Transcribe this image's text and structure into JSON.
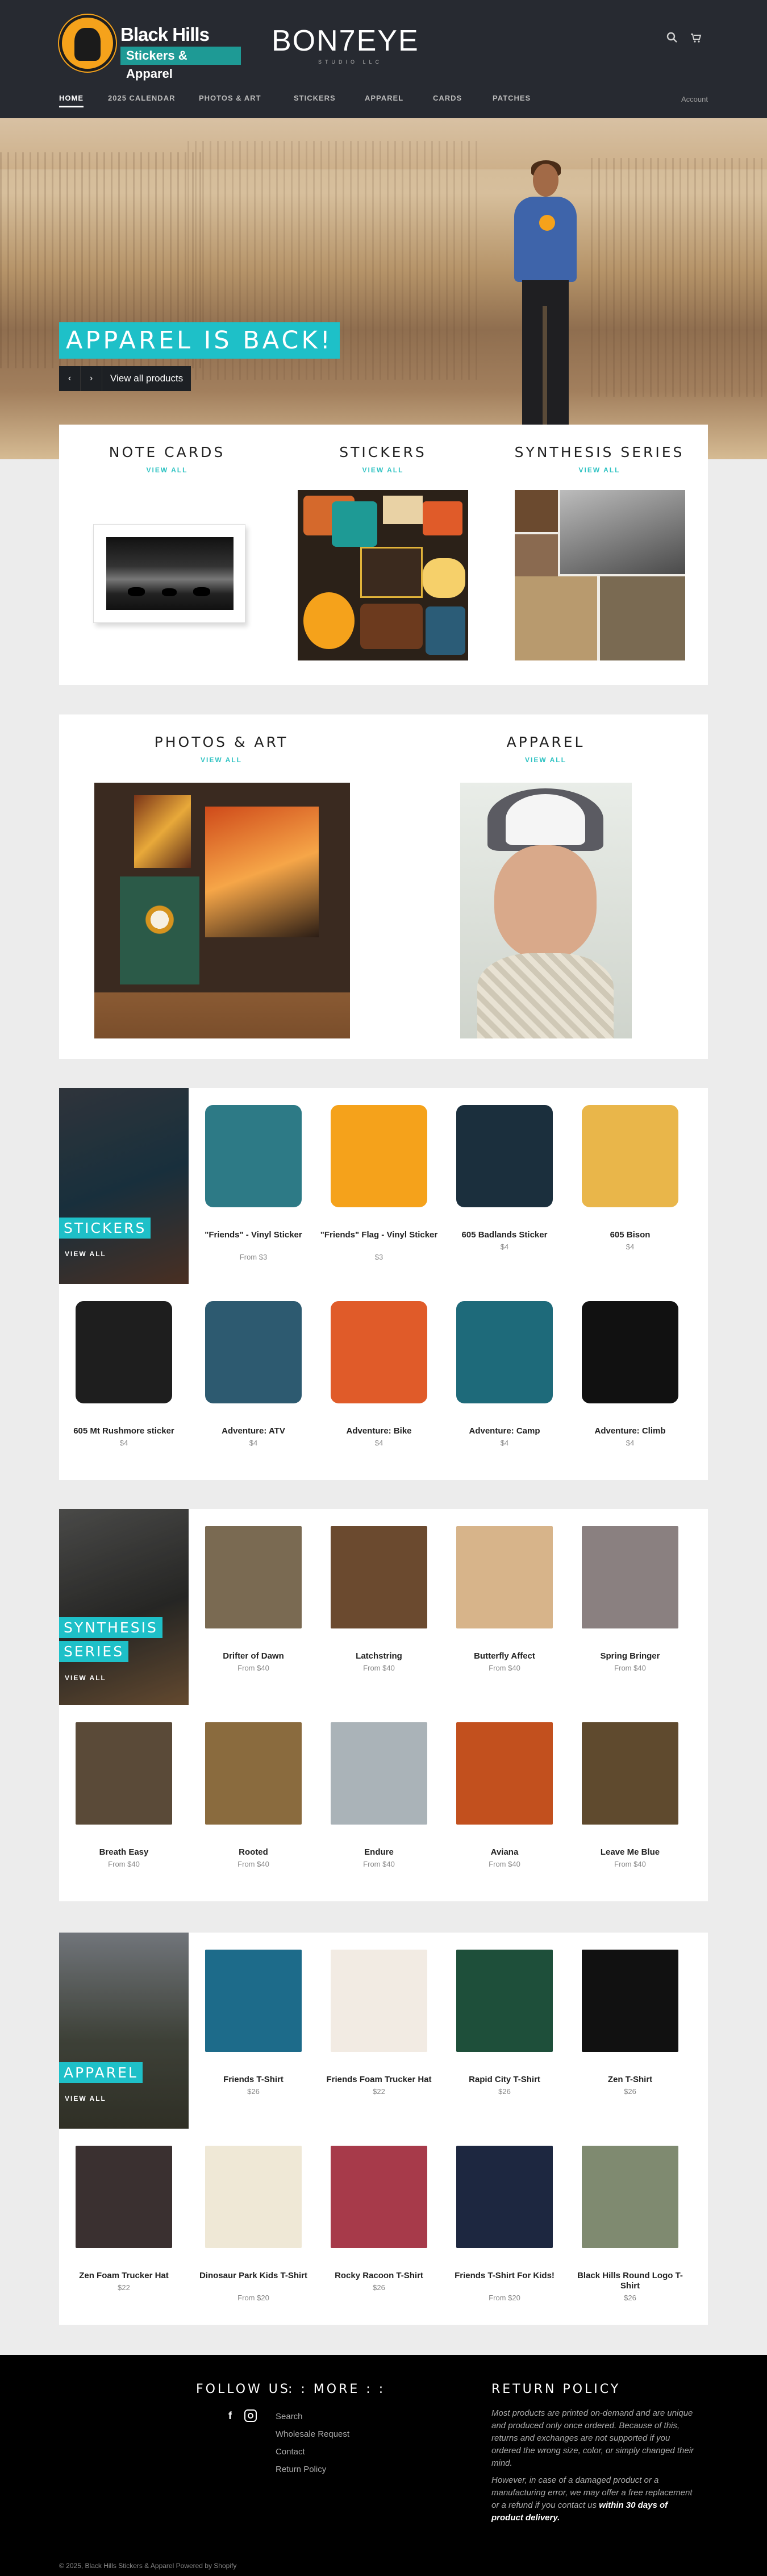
{
  "brand": {
    "name": "Black Hills",
    "subtitle": "Stickers & Apparel",
    "partner": "BON7EYE",
    "partner_sub": "STUDIO LLC"
  },
  "nav": [
    "HOME",
    "2025 CALENDAR",
    "PHOTOS & ART",
    "STICKERS",
    "APPAREL",
    "CARDS",
    "PATCHES"
  ],
  "account": "Account",
  "icons": {
    "search": "search-icon",
    "cart": "cart-icon",
    "facebook": "facebook-icon",
    "instagram": "instagram-icon"
  },
  "hero": {
    "title": "APPAREL IS BACK!",
    "prev": "‹",
    "next": "›",
    "cta": "View all products"
  },
  "view_all": "VIEW ALL",
  "collections_row1": [
    {
      "title": "NOTE CARDS"
    },
    {
      "title": "STICKERS"
    },
    {
      "title": "SYNTHESIS SERIES"
    }
  ],
  "collections_row2": [
    {
      "title": "PHOTOS & ART"
    },
    {
      "title": "APPAREL"
    }
  ],
  "sections": [
    {
      "title": "STICKERS",
      "products": [
        {
          "name": "\"Friends\" - Vinyl Sticker",
          "price": "From $3"
        },
        {
          "name": "\"Friends\" Flag - Vinyl Sticker",
          "price": "$3"
        },
        {
          "name": "605 Badlands Sticker",
          "price": "$4"
        },
        {
          "name": "605 Bison",
          "price": "$4"
        },
        {
          "name": "605 Mt Rushmore sticker",
          "price": "$4"
        },
        {
          "name": "Adventure: ATV",
          "price": "$4"
        },
        {
          "name": "Adventure: Bike",
          "price": "$4"
        },
        {
          "name": "Adventure: Camp",
          "price": "$4"
        },
        {
          "name": "Adventure: Climb",
          "price": "$4"
        }
      ]
    },
    {
      "title": "SYNTHESIS SERIES",
      "products": [
        {
          "name": "Drifter of Dawn",
          "price": "From $40"
        },
        {
          "name": "Latchstring",
          "price": "From $40"
        },
        {
          "name": "Butterfly Affect",
          "price": "From $40"
        },
        {
          "name": "Spring Bringer",
          "price": "From $40"
        },
        {
          "name": "Breath Easy",
          "price": "From $40"
        },
        {
          "name": "Rooted",
          "price": "From $40"
        },
        {
          "name": "Endure",
          "price": "From $40"
        },
        {
          "name": "Aviana",
          "price": "From $40"
        },
        {
          "name": "Leave Me Blue",
          "price": "From $40"
        }
      ]
    },
    {
      "title": "APPAREL",
      "products": [
        {
          "name": "Friends T-Shirt",
          "price": "$26"
        },
        {
          "name": "Friends Foam Trucker Hat",
          "price": "$22"
        },
        {
          "name": "Rapid City T-Shirt",
          "price": "$26"
        },
        {
          "name": "Zen T-Shirt",
          "price": "$26"
        },
        {
          "name": "Zen Foam Trucker Hat",
          "price": "$22"
        },
        {
          "name": "Dinosaur Park Kids T-Shirt",
          "price": "From $20"
        },
        {
          "name": "Rocky Racoon T-Shirt",
          "price": "$26"
        },
        {
          "name": "Friends T-Shirt For Kids!",
          "price": "From $20"
        },
        {
          "name": "Black Hills Round Logo T-Shirt",
          "price": "$26"
        }
      ]
    }
  ],
  "footer": {
    "follow_title": "FOLLOW US",
    "more_title": ": : MORE : :",
    "more_links": [
      "Search",
      "Wholesale Request",
      "Contact",
      "Return Policy"
    ],
    "return_title": "RETURN POLICY",
    "return_p1": "Most products are printed on-demand and are unique and produced only once ordered. Because of this, returns and exchanges are not supported if you ordered the wrong size, color, or simply changed their mind.",
    "return_p2": "However, in case of a damaged product or a manufacturing error, we may offer a free replacement or a refund if you contact us",
    "return_p2_bold": "within 30 days of product delivery.",
    "copyright": "© 2025, Black Hills Stickers & Apparel Powered by Shopify"
  }
}
